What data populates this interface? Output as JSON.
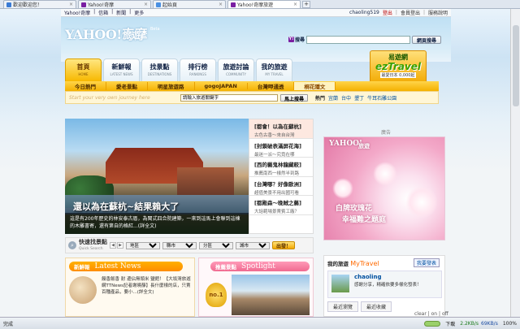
{
  "browser": {
    "tabs": [
      {
        "label": "歡迎歡迎您！",
        "color": "#3a7bd5",
        "active": false
      },
      {
        "label": "Yahoo!奇摩",
        "color": "#7a1fa2",
        "active": false
      },
      {
        "label": "起始頁",
        "color": "#4a90e2",
        "active": false
      },
      {
        "label": "Yahoo!奇摩旅遊",
        "color": "#7a1fa2",
        "active": true
      }
    ],
    "new_tab": "+",
    "close_glyph": "×"
  },
  "ybar": {
    "links": [
      "Yahoo!奇摩",
      "信箱",
      "新聞",
      "更多"
    ],
    "user": "chaoling519",
    "logout": "登出",
    "right_links": [
      "會員登出",
      "服務說明"
    ]
  },
  "header": {
    "logo": "YAHOO!奇摩",
    "section": "旅遊",
    "beta": "Beta",
    "search_label": "搜尋",
    "search_value": "",
    "search_button": "網頁搜尋"
  },
  "nav": [
    {
      "zh": "首頁",
      "en": "HOME",
      "active": true
    },
    {
      "zh": "新鮮報",
      "en": "LATEST NEWS",
      "active": false
    },
    {
      "zh": "找景點",
      "en": "DESTINATIONS",
      "active": false
    },
    {
      "zh": "排行榜",
      "en": "RANKINGS",
      "active": false
    },
    {
      "zh": "旅遊討論",
      "en": "COMMUNITY",
      "active": false
    },
    {
      "zh": "我的旅遊",
      "en": "MY TRAVEL",
      "active": false
    }
  ],
  "ez": {
    "title": "易遊網",
    "brand": "ezTravel",
    "count": "最愛日本 0,000起"
  },
  "subnav": [
    {
      "label": "今日熱門",
      "hl": false
    },
    {
      "label": "愛老景點",
      "hl": false
    },
    {
      "label": "明星旅遊路",
      "hl": false
    },
    {
      "label": "gogoJAPAN",
      "hl": false
    },
    {
      "label": "台灣呷通透",
      "hl": false
    },
    {
      "label": "桐花隱文",
      "hl": true
    }
  ],
  "journey": {
    "placeholder": "Start your very own journey here",
    "input_value": "請輸入旅遊關鍵字",
    "button": "馬上搜尋",
    "hot_label": "熱門",
    "hot_items": [
      "宜蘭",
      "台中",
      "墾丁",
      "牛耳石雕公園"
    ]
  },
  "feature": {
    "title": "還以為在蘇杭~結果賴大了",
    "desc": "這是有200年歷史的林安泰古厝，為閩式四合院建築，一來到這馬上會聯到這棟的木雕書寄，還有第自的格紅...(詳全文)"
  },
  "feature_list": [
    {
      "title": "[都會！以為在蘇杭]",
      "sub": "古色古香～來自台灣",
      "active": true
    },
    {
      "title": "[封鎖破表滿屏花海]",
      "sub": "最迷一派～究竟在哪",
      "active": false
    },
    {
      "title": "[西的藝鬼林龍藏較]",
      "sub": "推薦南西一樣然半到路",
      "active": false
    },
    {
      "title": "[台灣哪？好像歐洲]",
      "sub": "超值美景不用出國可看",
      "active": false
    },
    {
      "title": "[都殿森～晚賊之藝]",
      "sub": "大話範場景賣賓工廠？",
      "active": false
    }
  ],
  "quick_search": {
    "title": "快速找景點",
    "subtitle": "Quick Search",
    "selects": [
      "地區",
      "縣市",
      "分區",
      "城市"
    ],
    "go": "出發！"
  },
  "news": {
    "label_zh": "新鮮報",
    "label_en": "Latest News",
    "text": "饅香飯香 耐 邊佔無頭米 鹽館！【大坂灣旅遊網TTNews記者謝曉靜】長什麼樣的店，只賣百種產品，要小...(詳全文)"
  },
  "spotlight": {
    "label_zh": "推薦景點",
    "label_en": "Spotlight",
    "medal": "no.1"
  },
  "ad": {
    "label": "廣告",
    "logo": "YAHOO!",
    "sub": "旅遊",
    "line1": "白牌玫瑰花",
    "line2": "幸福難之題庭"
  },
  "my_travel": {
    "title": "我的旅遊",
    "title_en": "MyTravel",
    "button": "我要發表",
    "name": "chaoling",
    "message": "感謝分享，精確依要多樣化發表！",
    "tabs": [
      "最近瀏覽",
      "最近收藏"
    ]
  },
  "clear_toggle": "clear | on | off",
  "status": {
    "text": "完成",
    "download": "下載",
    "up_speed": "2.2KB/s",
    "down_speed": "69KB/s",
    "zoom": "100%"
  }
}
